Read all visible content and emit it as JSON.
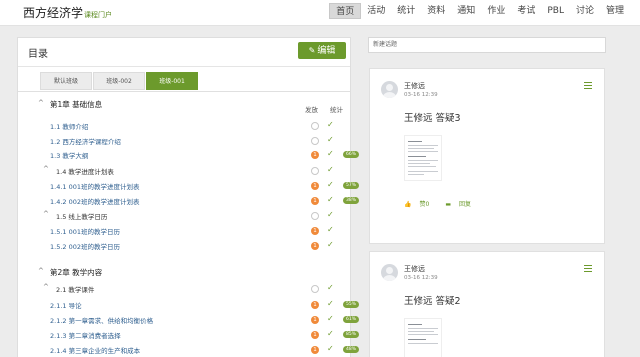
{
  "header": {
    "title": "西方经济学",
    "subtitle": "课程门户",
    "nav": [
      "首页",
      "活动",
      "统计",
      "资料",
      "通知",
      "作业",
      "考试",
      "PBL",
      "讨论",
      "管理"
    ],
    "active_nav": "首页"
  },
  "catalog": {
    "title": "目录",
    "edit_label": "编辑",
    "tabs": [
      "默认班级",
      "班级-002",
      "班级-001"
    ],
    "active_tab": "班级-001",
    "col_publish": "发放",
    "col_stats": "统计",
    "rows": [
      {
        "label": "第1章  基础信息",
        "type": "chapter",
        "chev": "^"
      },
      {
        "label": "1.1  教师介绍",
        "type": "item",
        "badge": "",
        "pct": ""
      },
      {
        "label": "1.2  西方经济学课程介绍",
        "type": "item",
        "badge": "",
        "pct": ""
      },
      {
        "label": "1.3  教学大纲",
        "type": "item",
        "badge": "1",
        "pct": "66%"
      },
      {
        "label": "1.4  教学进度计划表",
        "type": "section",
        "chev": "^",
        "badge": "",
        "pct": ""
      },
      {
        "label": "1.4.1 001班的教学进度计划表",
        "type": "item",
        "badge": "1",
        "pct": "57%"
      },
      {
        "label": "1.4.2 002班的教学进度计划表",
        "type": "item",
        "badge": "1",
        "pct": "38%"
      },
      {
        "label": "1.5  线上教学日历",
        "type": "section",
        "chev": "^",
        "badge": "",
        "pct": ""
      },
      {
        "label": "1.5.1 001班的教学日历",
        "type": "item",
        "badge": "1",
        "pct": ""
      },
      {
        "label": "1.5.2 002班的教学日历",
        "type": "item",
        "badge": "1",
        "pct": ""
      },
      {
        "label": "第2章  教学内容",
        "type": "chapter",
        "chev": "^"
      },
      {
        "label": "2.1  教学课件",
        "type": "section",
        "chev": "^",
        "badge": "",
        "pct": ""
      },
      {
        "label": "2.1.1  导论",
        "type": "item",
        "badge": "1",
        "pct": "55%"
      },
      {
        "label": "2.1.2  第一章需求、供给和均衡价格",
        "type": "item",
        "badge": "1",
        "pct": "61%"
      },
      {
        "label": "2.1.3  第二章消费者选择",
        "type": "item",
        "badge": "1",
        "pct": "85%"
      },
      {
        "label": "2.1.4  第三章企业的生产和成本",
        "type": "item",
        "badge": "1",
        "pct": "48%"
      }
    ]
  },
  "discussion": {
    "new_topic_placeholder": "新建话题",
    "posts": [
      {
        "author": "王修远",
        "time": "03-16 12:39",
        "title": "王修远 答疑3",
        "like": "赞0",
        "reply": "回复"
      },
      {
        "author": "王修远",
        "time": "03-16 12:39",
        "title": "王修远 答疑2"
      }
    ]
  },
  "colors": {
    "accent": "#6c9a2c",
    "badge": "#f08a3a"
  }
}
